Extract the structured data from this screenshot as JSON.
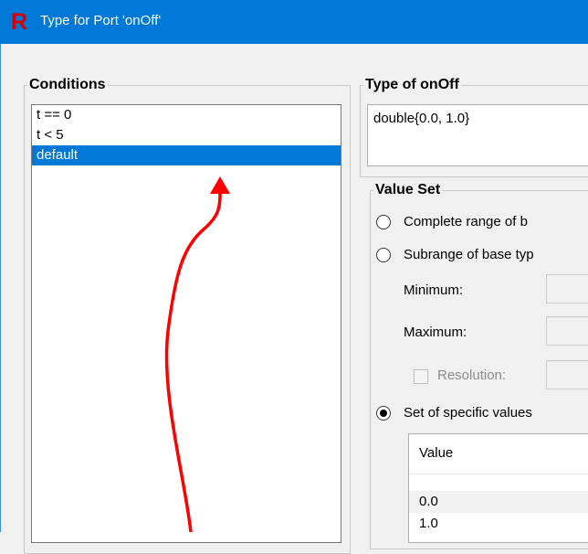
{
  "window": {
    "title": "Type for Port 'onOff'",
    "app_icon_glyph": "R"
  },
  "conditions": {
    "legend": "Conditions",
    "items": [
      "t == 0",
      "t < 5",
      "default"
    ],
    "selected_index": 2
  },
  "type_group": {
    "legend": "Type of onOff",
    "value": "double{0.0, 1.0}"
  },
  "value_set": {
    "legend": "Value Set",
    "option_complete": "Complete range of b",
    "option_subrange": "Subrange of base typ",
    "minimum_label": "Minimum:",
    "maximum_label": "Maximum:",
    "resolution_label": "Resolution:",
    "option_specific": "Set of specific values",
    "selected_option": "specific",
    "table": {
      "header": "Value",
      "rows": [
        "0.0",
        "1.0"
      ]
    }
  },
  "annotation": {
    "color": "#ff0000",
    "icon": "red-arrow-icon"
  },
  "colors": {
    "titlebar": "#0078d7",
    "selection": "#0078d7",
    "app_icon": "#d60000"
  }
}
